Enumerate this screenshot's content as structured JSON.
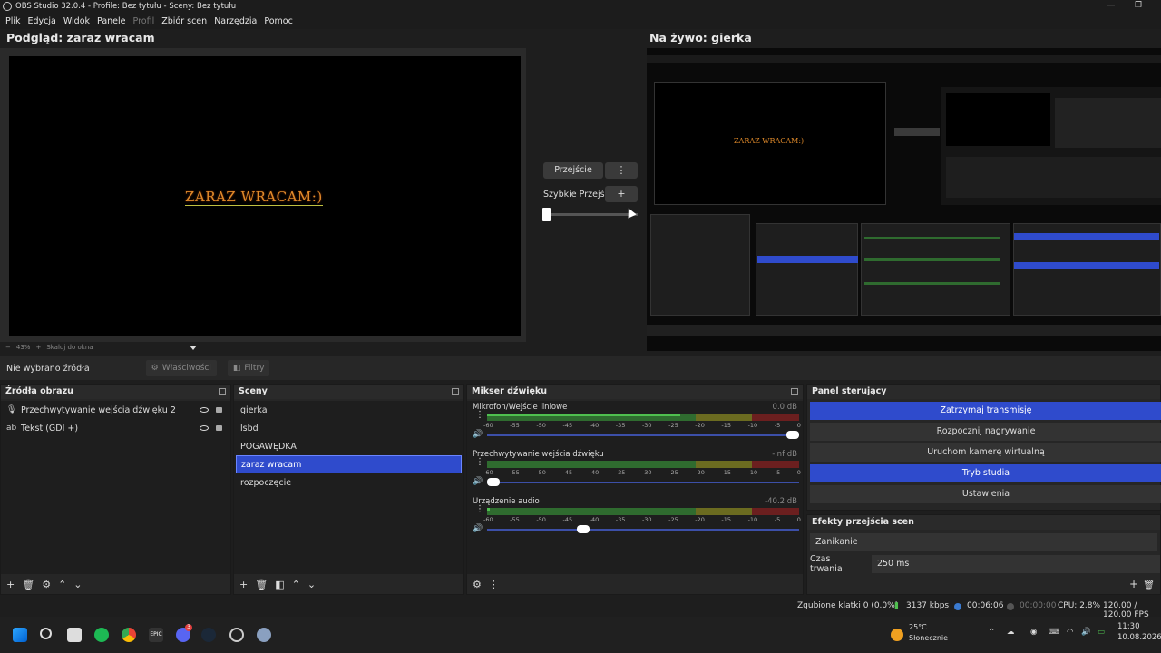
{
  "window": {
    "title": "OBS Studio 32.0.4 - Profile: Bez tytułu - Sceny: Bez tytułu",
    "min_glyph": "—",
    "max_glyph": "❐"
  },
  "menu": [
    "Plik",
    "Edycja",
    "Widok",
    "Panele",
    "Profil",
    "Zbiór scen",
    "Narzędzia",
    "Pomoc"
  ],
  "preview": {
    "title": "Podgląd: zaraz wracam",
    "content_text": "ZARAZ WRACAM:)",
    "zoom_minus": "−",
    "zoom_level": "43%",
    "zoom_plus": "+",
    "zoom_mode": "Skaluj do okna"
  },
  "program": {
    "title": "Na żywo: gierka"
  },
  "transition": {
    "button": "Przejście",
    "quick_label": "Szybkie Przejścia",
    "dots": "⋮",
    "plus": "+"
  },
  "source_toolbar": {
    "no_source": "Nie wybrano źródła",
    "properties": "Właściwości",
    "filters": "Filtry"
  },
  "sources": {
    "title": "Źródła obrazu",
    "items": [
      {
        "label": "Przechwytywanie wejścia dźwięku 2",
        "icon": "microphone-icon"
      },
      {
        "label": "Tekst (GDI +)",
        "icon": "text-icon"
      }
    ]
  },
  "scenes": {
    "title": "Sceny",
    "items": [
      "gierka",
      "lsbd",
      "POGAWĘDKA",
      "zaraz wracam",
      "rozpoczęcie"
    ],
    "active": "zaraz wracam"
  },
  "mixer": {
    "title": "Mikser dźwięku",
    "channels": [
      {
        "name": "Mikrofon/Wejście liniowe",
        "db": "0.0 dB",
        "level": 0.62,
        "volume": 1.0
      },
      {
        "name": "Przechwytywanie wejścia dźwięku",
        "db": "-inf dB",
        "level": 0.0,
        "volume": 0.0
      },
      {
        "name": "Urządzenie audio",
        "db": "-40.2 dB",
        "level": 0.01,
        "volume": 0.3
      }
    ],
    "ticks": [
      "-60",
      "-55",
      "-50",
      "-45",
      "-40",
      "-35",
      "-30",
      "-25",
      "-20",
      "-15",
      "-10",
      "-5",
      "0"
    ]
  },
  "controls": {
    "title": "Panel sterujący",
    "buttons": [
      {
        "label": "Zatrzymaj transmisję",
        "active": true
      },
      {
        "label": "Rozpocznij nagrywanie",
        "active": false
      },
      {
        "label": "Uruchom kamerę wirtualną",
        "active": false
      },
      {
        "label": "Tryb studia",
        "active": true
      },
      {
        "label": "Ustawienia",
        "active": false
      }
    ]
  },
  "transitions_dock": {
    "title": "Efekty przejścia scen",
    "selected": "Zanikanie",
    "duration_label": "Czas trwania",
    "duration_value": "250 ms"
  },
  "status": {
    "dropped": "Zgubione klatki 0 (0.0%)",
    "bitrate": "3137 kbps",
    "stream_time": "00:06:06",
    "rec_time": "00:00:00",
    "cpu": "CPU: 2.8%",
    "fps": "120.00 / 120.00 FPS"
  },
  "taskbar": {
    "weather_temp": "25°C",
    "weather_desc": "Słonecznie",
    "time": "11:30",
    "date": "10.08.2026",
    "badge_count": "3",
    "epic_label": "EPIC"
  },
  "colors": {
    "accent_blue": "#2f4bcc",
    "meter_green": "#2f6b2f",
    "meter_yellow": "#6b6b20",
    "meter_red": "#6b1f1f"
  }
}
